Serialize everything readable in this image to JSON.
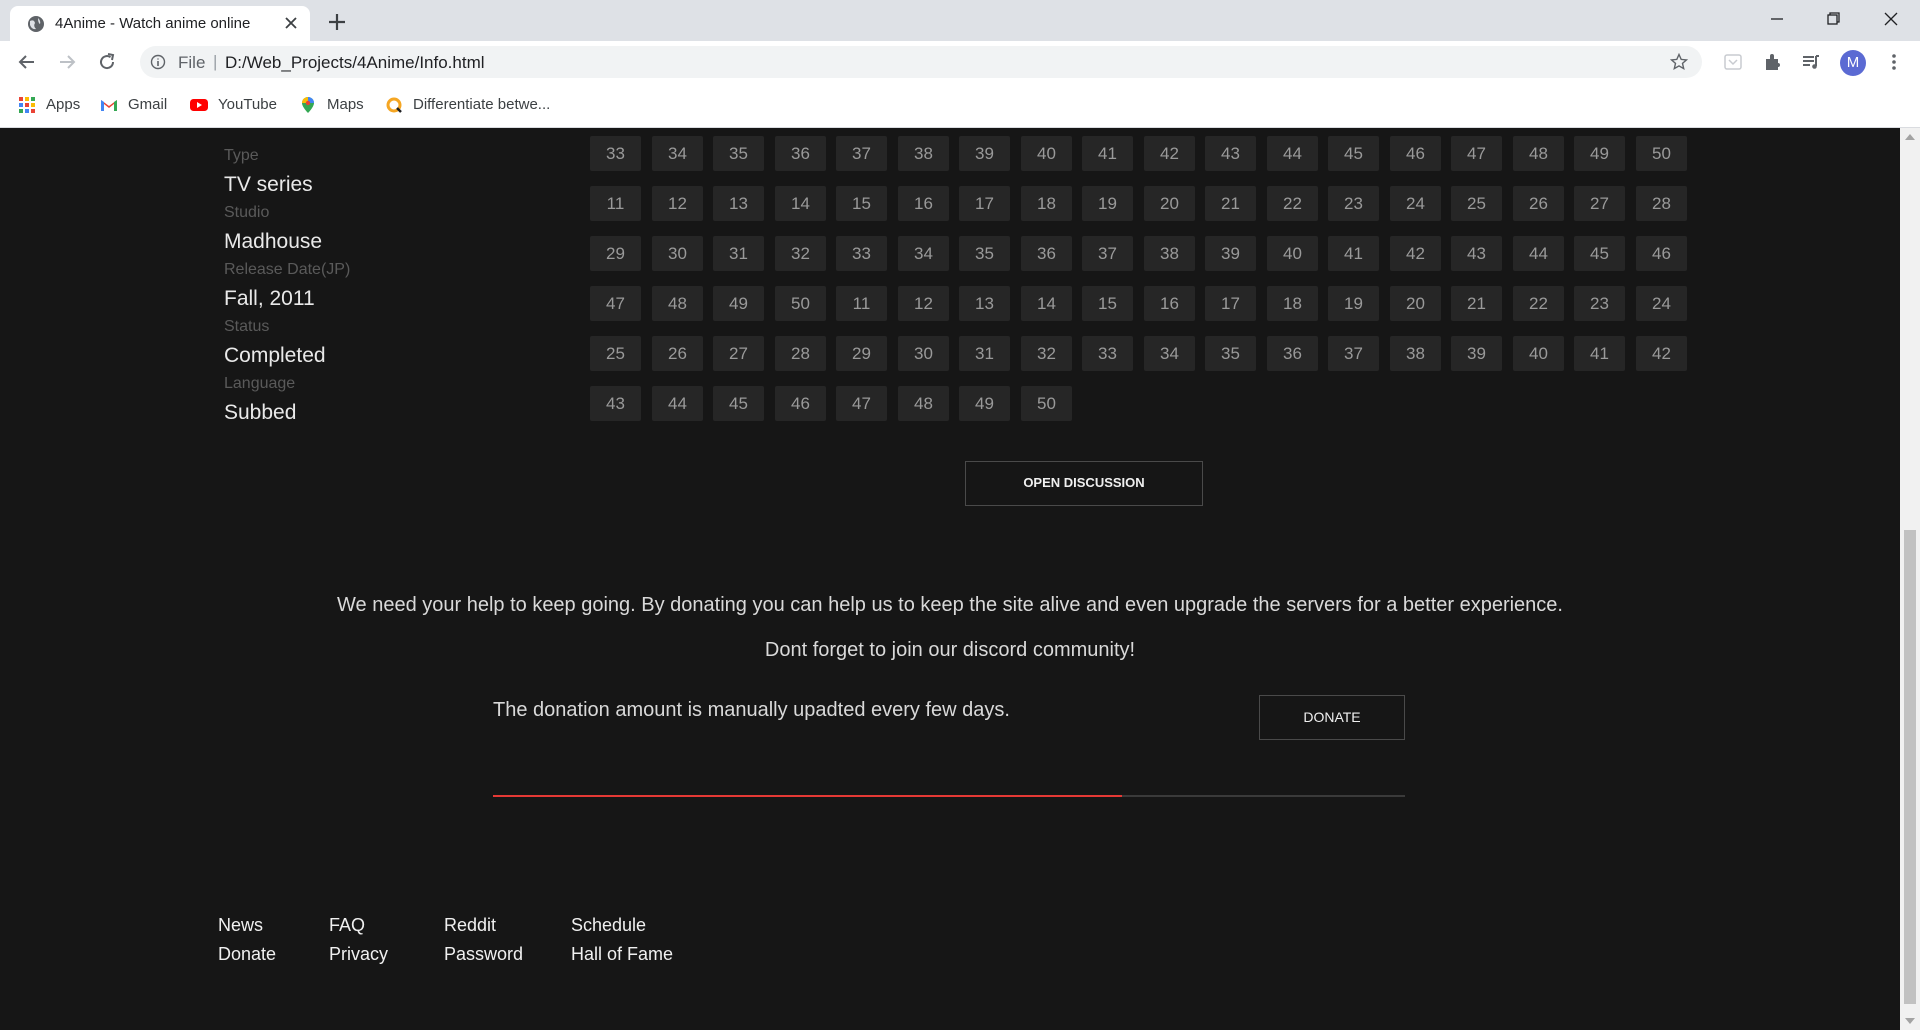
{
  "browser": {
    "tab_title": "4Anime - Watch anime online",
    "scheme": "File",
    "url": "D:/Web_Projects/4Anime/Info.html",
    "avatar_letter": "M",
    "bookmarks": [
      "Apps",
      "Gmail",
      "YouTube",
      "Maps",
      "Differentiate betwe..."
    ]
  },
  "info": [
    {
      "label": "Type",
      "value": "TV series"
    },
    {
      "label": "Studio",
      "value": "Madhouse"
    },
    {
      "label": "Release Date(JP)",
      "value": "Fall, 2011"
    },
    {
      "label": "Status",
      "value": "Completed"
    },
    {
      "label": "Language",
      "value": "Subbed"
    }
  ],
  "episodes": [
    [
      "33",
      "34",
      "35",
      "36",
      "37",
      "38",
      "39",
      "40",
      "41",
      "42",
      "43",
      "44",
      "45",
      "46",
      "47",
      "48",
      "49",
      "50"
    ],
    [
      "11",
      "12",
      "13",
      "14",
      "15",
      "16",
      "17",
      "18",
      "19",
      "20",
      "21",
      "22",
      "23",
      "24",
      "25",
      "26",
      "27",
      "28"
    ],
    [
      "29",
      "30",
      "31",
      "32",
      "33",
      "34",
      "35",
      "36",
      "37",
      "38",
      "39",
      "40",
      "41",
      "42",
      "43",
      "44",
      "45",
      "46"
    ],
    [
      "47",
      "48",
      "49",
      "50",
      "11",
      "12",
      "13",
      "14",
      "15",
      "16",
      "17",
      "18",
      "19",
      "20",
      "21",
      "22",
      "23",
      "24"
    ],
    [
      "25",
      "26",
      "27",
      "28",
      "29",
      "30",
      "31",
      "32",
      "33",
      "34",
      "35",
      "36",
      "37",
      "38",
      "39",
      "40",
      "41",
      "42"
    ],
    [
      "43",
      "44",
      "45",
      "46",
      "47",
      "48",
      "49",
      "50"
    ]
  ],
  "open_discussion_label": "OPEN DISCUSSION",
  "donation": {
    "message": "We need your help to keep going. By donating you can help us to keep the site alive and even upgrade the servers for a better experience.",
    "discord": "Dont forget to join our discord community!",
    "note": "The donation amount is manually upadted every few days.",
    "button_label": "DONATE",
    "progress_fraction": 0.69
  },
  "footer": [
    [
      "News",
      "Donate"
    ],
    [
      "FAQ",
      "Privacy"
    ],
    [
      "Reddit",
      "Password"
    ],
    [
      "Schedule",
      "Hall of Fame"
    ]
  ],
  "colors": {
    "accent": "#e53935",
    "background": "#161616",
    "tile": "#262626"
  }
}
